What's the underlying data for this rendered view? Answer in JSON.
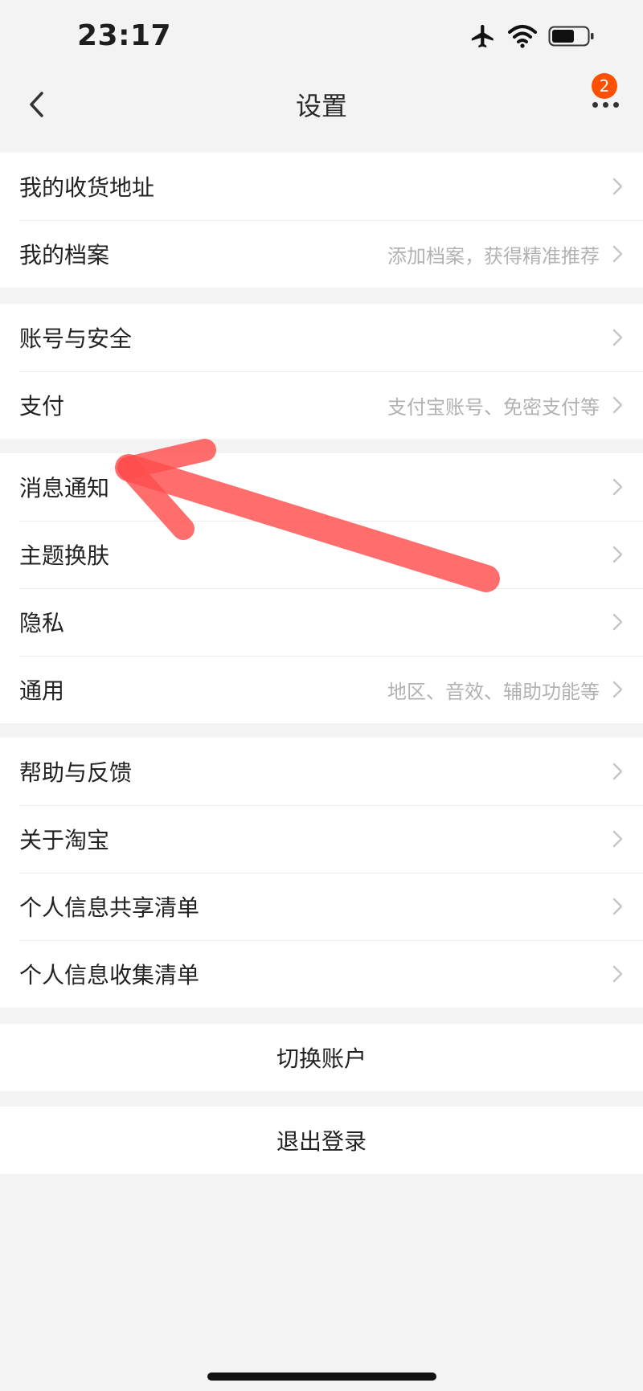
{
  "status_bar": {
    "time": "23:17",
    "icons": [
      "airplane-icon",
      "wifi-icon",
      "battery-icon"
    ]
  },
  "nav": {
    "title": "设置",
    "badge_count": "2",
    "back_icon": "chevron-left-icon",
    "more_icon": "more-dots-icon"
  },
  "groups": [
    {
      "items": [
        {
          "label": "我的收货地址",
          "hint": ""
        },
        {
          "label": "我的档案",
          "hint": "添加档案，获得精准推荐"
        }
      ]
    },
    {
      "items": [
        {
          "label": "账号与安全",
          "hint": ""
        },
        {
          "label": "支付",
          "hint": "支付宝账号、免密支付等"
        }
      ]
    },
    {
      "items": [
        {
          "label": "消息通知",
          "hint": ""
        },
        {
          "label": "主题换肤",
          "hint": ""
        },
        {
          "label": "隐私",
          "hint": ""
        },
        {
          "label": "通用",
          "hint": "地区、音效、辅助功能等"
        }
      ]
    },
    {
      "items": [
        {
          "label": "帮助与反馈",
          "hint": ""
        },
        {
          "label": "关于淘宝",
          "hint": ""
        },
        {
          "label": "个人信息共享清单",
          "hint": ""
        },
        {
          "label": "个人信息收集清单",
          "hint": ""
        }
      ]
    }
  ],
  "actions": {
    "switch_account": "切换账户",
    "logout": "退出登录"
  },
  "colors": {
    "accent": "#ff5000",
    "annotation": "#ff4d4d",
    "background": "#f3f3f3",
    "hint_text": "#b2b2b2"
  }
}
